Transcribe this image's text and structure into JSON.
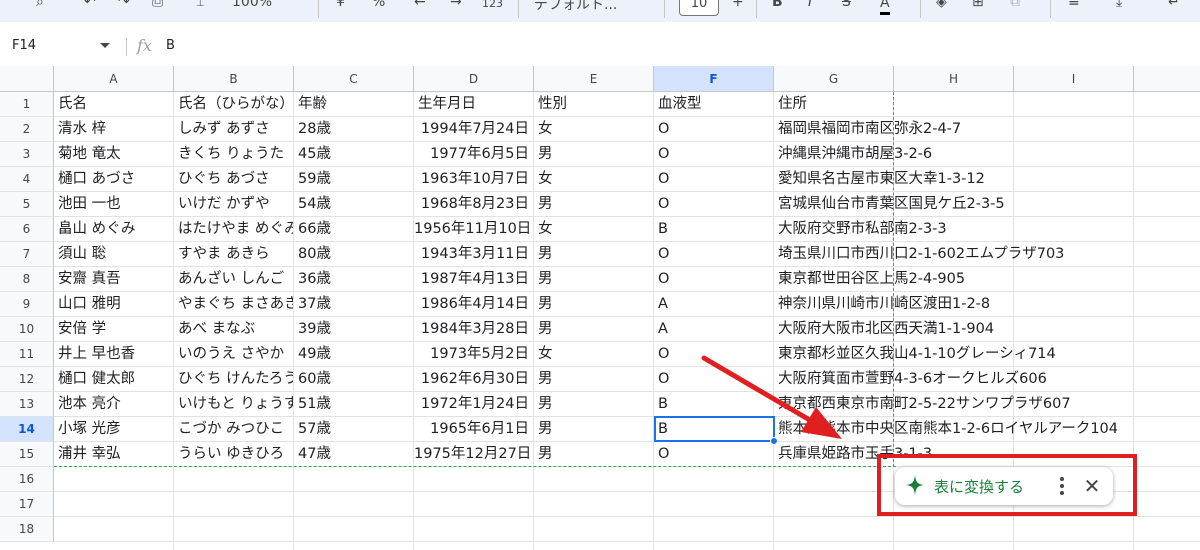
{
  "toolbar": {
    "zoom": "100%",
    "percent": "%",
    "decimal_more": "123",
    "font_name": "デフォルト...",
    "font_size": "10",
    "bold": "B",
    "italic": "I",
    "strike": "S",
    "text_color": "A"
  },
  "formula_bar": {
    "name_box": "F14",
    "fx": "fx",
    "value": "B"
  },
  "columns": [
    "A",
    "B",
    "C",
    "D",
    "E",
    "F",
    "G",
    "H",
    "I"
  ],
  "row_numbers": [
    "1",
    "2",
    "3",
    "4",
    "5",
    "6",
    "7",
    "8",
    "9",
    "10",
    "11",
    "12",
    "13",
    "14",
    "15",
    "16",
    "17",
    "18"
  ],
  "header_row": [
    "氏名",
    "氏名（ひらがな）",
    "年齢",
    "生年月日",
    "性別",
    "血液型",
    "住所"
  ],
  "rows": [
    [
      "清水 梓",
      "しみず あずさ",
      "28歳",
      "1994年7月24日",
      "女",
      "O",
      "福岡県福岡市南区弥永2-4-7"
    ],
    [
      "菊地 竜太",
      "きくち りょうた",
      "45歳",
      "1977年6月5日",
      "男",
      "O",
      "沖縄県沖縄市胡屋3-2-6"
    ],
    [
      "樋口 あづさ",
      "ひぐち あづさ",
      "59歳",
      "1963年10月7日",
      "女",
      "O",
      "愛知県名古屋市東区大幸1-3-12"
    ],
    [
      "池田 一也",
      "いけだ かずや",
      "54歳",
      "1968年8月23日",
      "男",
      "O",
      "宮城県仙台市青葉区国見ケ丘2-3-5"
    ],
    [
      "畠山 めぐみ",
      "はたけやま めぐみ",
      "66歳",
      "1956年11月10日",
      "女",
      "B",
      "大阪府交野市私部南2-3-3"
    ],
    [
      "須山 聡",
      "すやま あきら",
      "80歳",
      "1943年3月11日",
      "男",
      "O",
      "埼玉県川口市西川口2-1-602エムプラザ703"
    ],
    [
      "安齋 真吾",
      "あんざい しんご",
      "36歳",
      "1987年4月13日",
      "男",
      "O",
      "東京都世田谷区上馬2-4-905"
    ],
    [
      "山口 雅明",
      "やまぐち まさあき",
      "37歳",
      "1986年4月14日",
      "男",
      "A",
      "神奈川県川崎市川崎区渡田1-2-8"
    ],
    [
      "安倍 学",
      "あべ まなぶ",
      "39歳",
      "1984年3月28日",
      "男",
      "A",
      "大阪府大阪市北区西天満1-1-904"
    ],
    [
      "井上 早也香",
      "いのうえ さやか",
      "49歳",
      "1973年5月2日",
      "女",
      "O",
      "東京都杉並区久我山4-1-10グレーシィ714"
    ],
    [
      "樋口 健太郎",
      "ひぐち けんたろう",
      "60歳",
      "1962年6月30日",
      "男",
      "O",
      "大阪府箕面市萱野4-3-6オークヒルズ606"
    ],
    [
      "池本 亮介",
      "いけもと りょうすけ",
      "51歳",
      "1972年1月24日",
      "男",
      "B",
      "東京都西東京市南町2-5-22サンワプラザ607"
    ],
    [
      "小塚 光彦",
      "こづか みつひこ",
      "57歳",
      "1965年6月1日",
      "男",
      "B",
      "熊本県熊本市中央区南熊本1-2-6ロイヤルアーク104"
    ],
    [
      "浦井 幸弘",
      "うらい ゆきひろ",
      "47歳",
      "1975年12月27日",
      "男",
      "O",
      "兵庫県姫路市玉手3-1-3"
    ]
  ],
  "convert_chip": {
    "label": "表に変換する"
  },
  "colors": {
    "selection": "#1a73e8",
    "highlight": "#e02020",
    "chip_text": "#188038"
  }
}
